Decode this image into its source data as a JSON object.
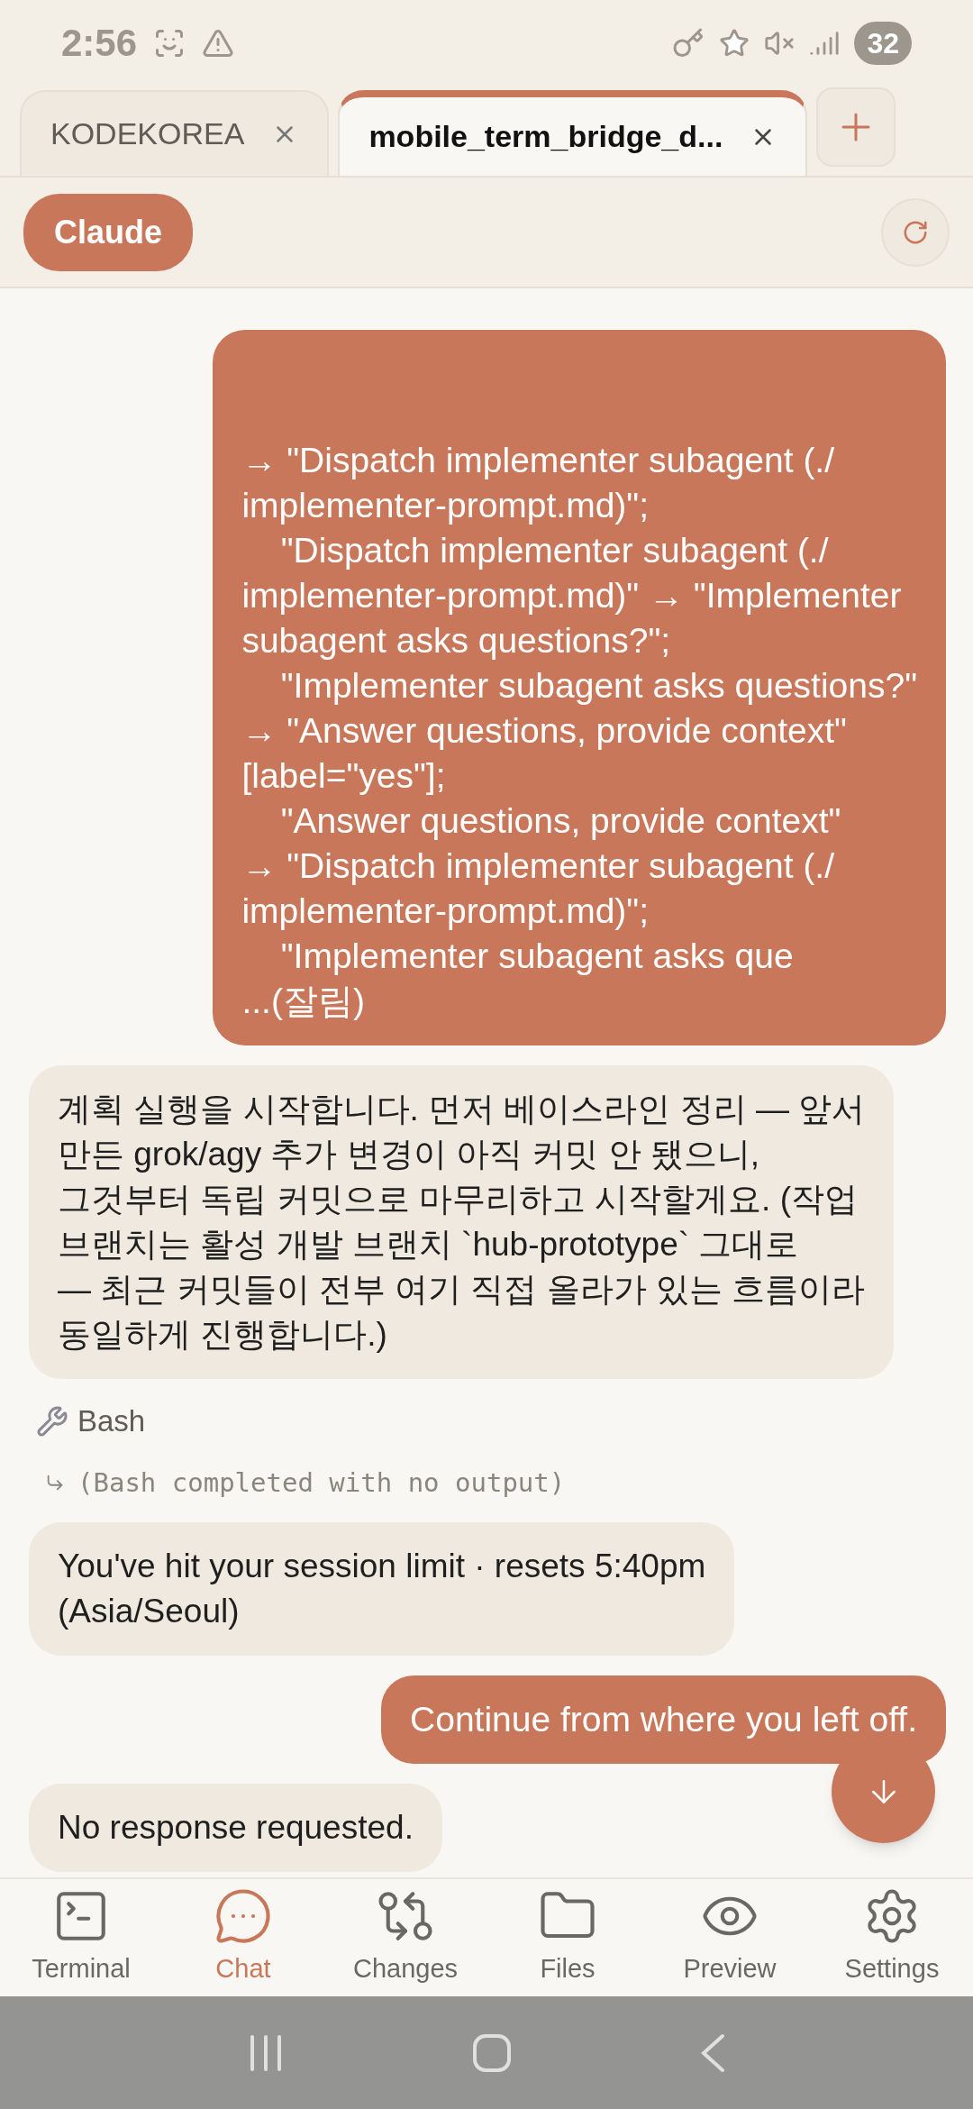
{
  "status_bar": {
    "time": "2:56",
    "battery": "32"
  },
  "tabs": [
    {
      "label": "KODEKOREA",
      "selected": false
    },
    {
      "label": "mobile_term_bridge_d...",
      "selected": true
    }
  ],
  "header": {
    "agent_button": "Claude"
  },
  "messages": [
    {
      "kind": "user",
      "lines": [
        "→ \"Dispatch implementer subagent (./",
        "implementer-prompt.md)\";",
        "    \"Dispatch implementer subagent (./",
        "implementer-prompt.md)\" → \"Implementer",
        "subagent asks questions?\";",
        "    \"Implementer subagent asks questions?\"",
        "→ \"Answer questions, provide context\"",
        "[label=\"yes\"];",
        "    \"Answer questions, provide context\"",
        "→ \"Dispatch implementer subagent (./",
        "implementer-prompt.md)\";",
        "    \"Implementer subagent asks que",
        "...(잘림)"
      ]
    },
    {
      "kind": "assistant",
      "lines": [
        "계획 실행을 시작합니다. 먼저 베이스라인 정리 — 앞서",
        "만든 grok/agy 추가 변경이 아직 커밋 안 됐으니,",
        "그것부터 독립 커밋으로 마무리하고 시작할게요. (작업",
        "브랜치는 활성 개발 브랜치 `hub-prototype` 그대로",
        "— 최근 커밋들이 전부 여기 직접 올라가 있는 흐름이라",
        "동일하게 진행합니다.)"
      ]
    },
    {
      "kind": "tool",
      "lines": [
        "Bash"
      ]
    },
    {
      "kind": "tool_output",
      "lines": [
        "(Bash completed with no output)"
      ]
    },
    {
      "kind": "assistant",
      "lines": [
        "You've hit your session limit · resets 5:40pm",
        "(Asia/Seoul)"
      ]
    },
    {
      "kind": "user",
      "lines": [
        "Continue from where you left off."
      ]
    },
    {
      "kind": "assistant",
      "lines": [
        "No response requested."
      ]
    }
  ],
  "bottom_nav": [
    {
      "label": "Terminal",
      "selected": false
    },
    {
      "label": "Chat",
      "selected": true
    },
    {
      "label": "Changes",
      "selected": false
    },
    {
      "label": "Files",
      "selected": false
    },
    {
      "label": "Preview",
      "selected": false
    },
    {
      "label": "Settings",
      "selected": false
    }
  ]
}
